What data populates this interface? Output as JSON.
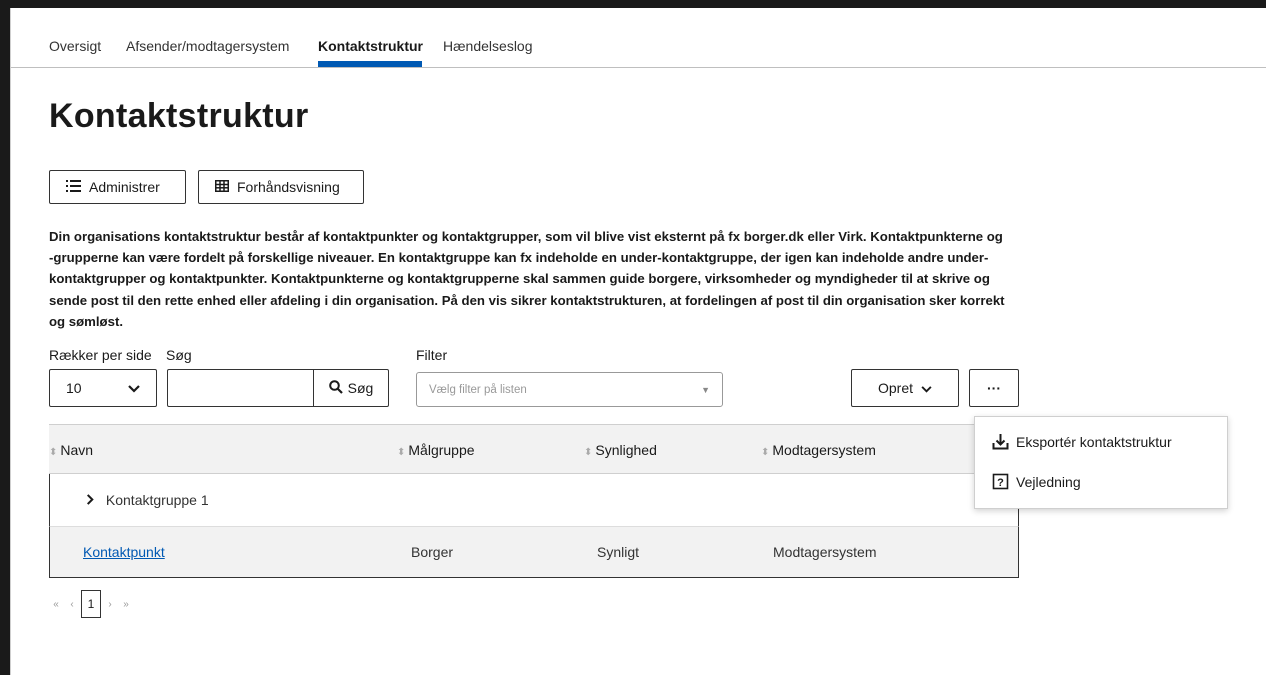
{
  "tabs": [
    {
      "label": "Oversigt"
    },
    {
      "label": "Afsender/modtagersystem"
    },
    {
      "label": "Kontaktstruktur"
    },
    {
      "label": "Hændelseslog"
    }
  ],
  "page": {
    "title": "Kontaktstruktur",
    "administrer_label": "Administrer",
    "preview_label": "Forhåndsvisning",
    "description": "Din organisations kontaktstruktur består af kontaktpunkter og kontaktgrupper, som vil blive vist eksternt på fx borger.dk eller Virk. Kontaktpunkterne og -grupperne kan være fordelt på forskellige niveauer. En kontaktgruppe kan fx indeholde en under-kontaktgruppe, der igen kan indeholde andre under-kontaktgrupper og kontaktpunkter. Kontaktpunkterne og kontaktgrupperne skal sammen guide borgere, virksomheder og myndigheder til at skrive og sende post til den rette enhed eller afdeling i din organisation. På den vis sikrer kontaktstrukturen, at fordelingen af post til din organisation sker korrekt og sømløst."
  },
  "controls": {
    "rows_label": "Rækker per side",
    "rows_value": "10",
    "search_label": "Søg",
    "search_value": "",
    "search_button": "Søg",
    "filter_label": "Filter",
    "filter_placeholder": "Vælg filter på listen",
    "create_label": "Opret",
    "more_label": "···"
  },
  "table": {
    "columns": [
      "Navn",
      "Målgruppe",
      "Synlighed",
      "Modtagersystem"
    ],
    "group_row": {
      "name": "Kontaktgruppe 1"
    },
    "rows": [
      {
        "name": "Kontaktpunkt",
        "target": "Borger",
        "visibility": "Synligt",
        "system": "Modtagersystem"
      }
    ]
  },
  "pagination": {
    "first": "«",
    "prev": "‹",
    "current": "1",
    "next": "›",
    "last": "»"
  },
  "menu": {
    "items": [
      {
        "label": "Eksportér kontaktstruktur",
        "icon": "download-icon"
      },
      {
        "label": "Vejledning",
        "icon": "help-icon"
      }
    ]
  },
  "colors": {
    "accent": "#0059b3",
    "header_bg": "#f2f2f2",
    "text": "#1a1a1a"
  }
}
